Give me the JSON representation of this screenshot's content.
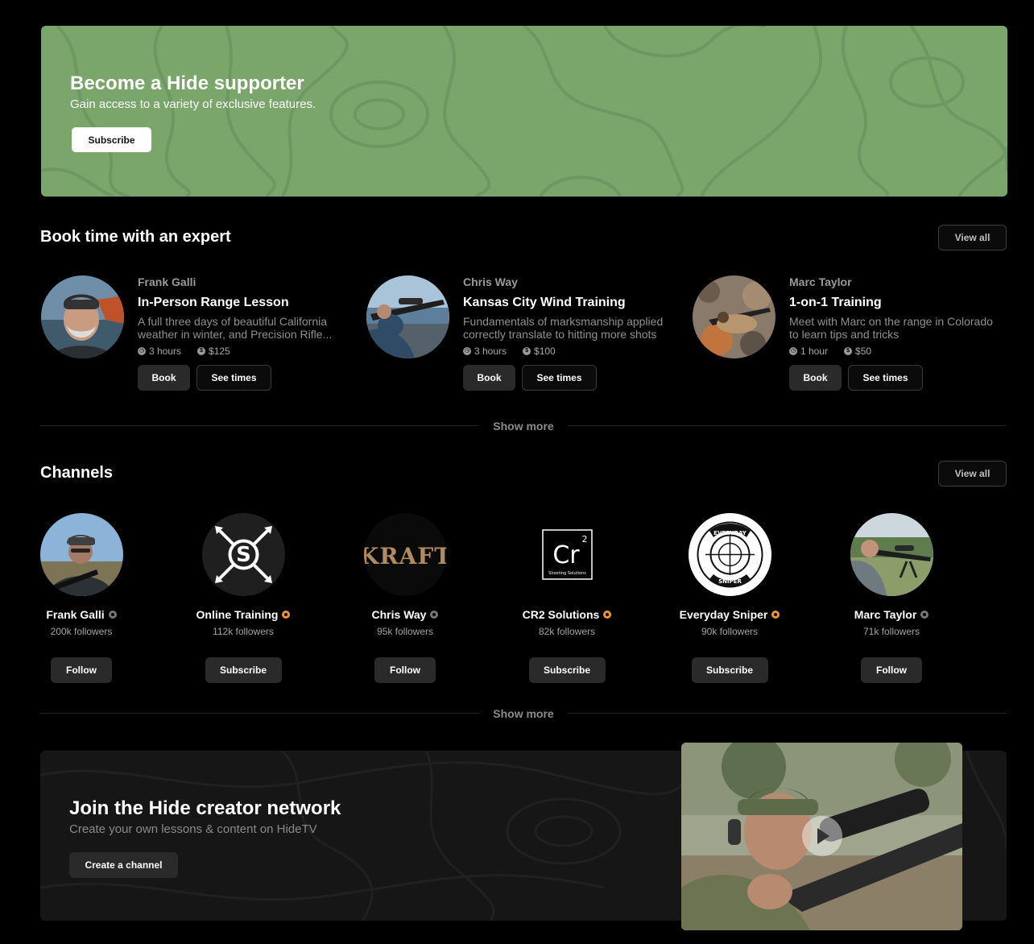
{
  "supporter": {
    "title": "Become a Hide supporter",
    "subtitle": "Gain access to a variety of exclusive features.",
    "button": "Subscribe"
  },
  "experts_section": {
    "title": "Book time with an expert",
    "view_all": "View all",
    "show_more": "Show more",
    "items": [
      {
        "name": "Frank Galli",
        "lesson": "In-Person Range Lesson",
        "description": "A full three days of beautiful California weather in winter, and Precision Rifle...",
        "duration": "3 hours",
        "price": "$125",
        "book": "Book",
        "see_times": "See times"
      },
      {
        "name": "Chris Way",
        "lesson": "Kansas City Wind Training",
        "description": "Fundamentals of marksmanship applied correctly translate to hitting more shots",
        "duration": "3 hours",
        "price": "$100",
        "book": "Book",
        "see_times": "See times"
      },
      {
        "name": "Marc Taylor",
        "lesson": "1-on-1 Training",
        "description": "Meet with Marc on the range in Colorado to learn tips and tricks",
        "duration": "1 hour",
        "price": "$50",
        "book": "Book",
        "see_times": "See times"
      }
    ]
  },
  "channels_section": {
    "title": "Channels",
    "view_all": "View all",
    "show_more": "Show more",
    "items": [
      {
        "name": "Frank Galli",
        "followers": "200k followers",
        "action": "Follow",
        "badge": "gray"
      },
      {
        "name": "Online Training",
        "followers": "112k followers",
        "action": "Subscribe",
        "badge": "orange"
      },
      {
        "name": "Chris Way",
        "followers": "95k followers",
        "action": "Follow",
        "badge": "gray"
      },
      {
        "name": "CR2 Solutions",
        "followers": "82k followers",
        "action": "Subscribe",
        "badge": "orange"
      },
      {
        "name": "Everyday Sniper",
        "followers": "90k followers",
        "action": "Subscribe",
        "badge": "orange"
      },
      {
        "name": "Marc Taylor",
        "followers": "71k followers",
        "action": "Follow",
        "badge": "gray"
      }
    ],
    "logos": {
      "kraft": "KRAFT",
      "cr2_symbol": "Cr",
      "cr2_superscript": "2",
      "cr2_caption": "Shooting Solutions",
      "everyday_top": "EVERYDAY",
      "everyday_bottom": "SNIPER"
    }
  },
  "creator": {
    "title": "Join the Hide creator network",
    "subtitle": "Create your own lessons & content on HideTV",
    "button": "Create a channel"
  },
  "colors": {
    "banner_green": "#7aa56b",
    "badge_orange": "#f0952a",
    "badge_gray": "#777777"
  }
}
